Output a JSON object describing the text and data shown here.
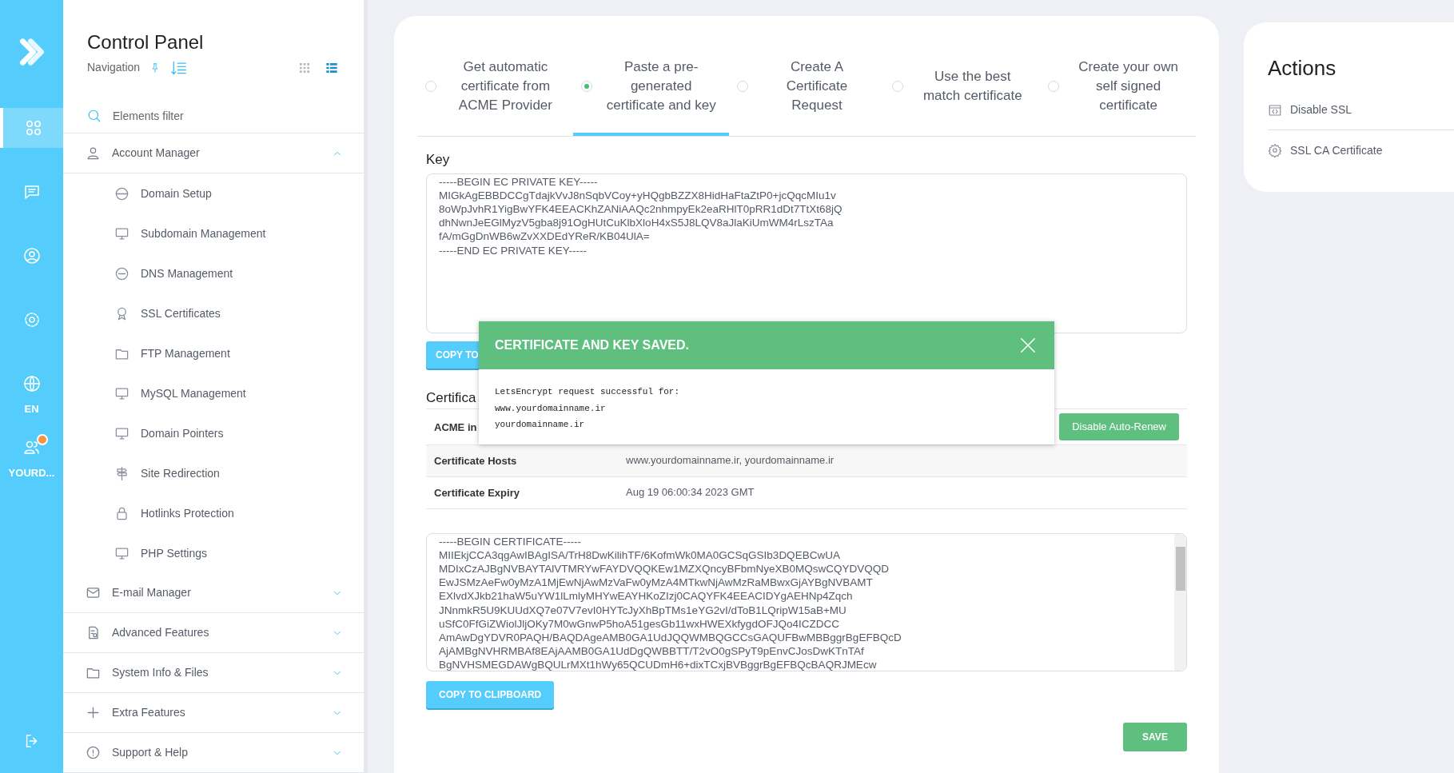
{
  "rail": {
    "items": [
      {
        "kind": "apps",
        "selected": true
      },
      {
        "kind": "chat",
        "selected": false
      },
      {
        "kind": "user",
        "selected": false
      },
      {
        "kind": "gear",
        "selected": false
      },
      {
        "kind": "globe",
        "selected": false,
        "label": "EN"
      },
      {
        "kind": "account",
        "selected": false,
        "label": "YOURD...",
        "notification": true
      }
    ]
  },
  "sidebar": {
    "title": "Control Panel",
    "subtitle": "Navigation",
    "view_toggle": [
      {
        "selected": false
      },
      {
        "selected": true
      }
    ],
    "filter": {
      "placeholder": "Elements filter"
    },
    "groups": [
      {
        "label": "Account Manager",
        "expanded": true,
        "children": [
          {
            "label": "Domain Setup"
          },
          {
            "label": "Subdomain Management"
          },
          {
            "label": "DNS Management"
          },
          {
            "label": "SSL Certificates"
          },
          {
            "label": "FTP Management"
          },
          {
            "label": "MySQL Management"
          },
          {
            "label": "Domain Pointers"
          },
          {
            "label": "Site Redirection"
          },
          {
            "label": "Hotlinks Protection"
          },
          {
            "label": "PHP Settings"
          }
        ]
      },
      {
        "label": "E-mail Manager",
        "expanded": false
      },
      {
        "label": "Advanced Features",
        "expanded": false
      },
      {
        "label": "System Info & Files",
        "expanded": false
      },
      {
        "label": "Extra Features",
        "expanded": false
      },
      {
        "label": "Support & Help",
        "expanded": false
      }
    ]
  },
  "tabs": [
    {
      "label": "Get automatic certificate from ACME Provider",
      "selected": false
    },
    {
      "label": "Paste a pre-generated certificate and key",
      "selected": true
    },
    {
      "label": "Create A Certificate Request",
      "selected": false
    },
    {
      "label": "Use the best match certificate",
      "selected": false
    },
    {
      "label": "Create your own self signed certificate",
      "selected": false
    }
  ],
  "key": {
    "label": "Key",
    "lines": [
      "-----BEGIN EC PRIVATE KEY-----",
      "MIGkAgEBBDCCgTdajkVvJ8nSqbVCoy+yHQgbBZZX8HidHaFtaZtP0+jcQqcMIu1v",
      "8oWpJvhR1YigBwYFK4EEACKhZANiAAQc2nhmpyEk2eaRHlT0pRR1dDt7TtXt68jQ",
      "dhNwnJeEGlMyzV5gba8j91OgHUtCuKlbXloH4xS5J8LQV8aJlaKiUmWM4rLszTAa",
      "fA/mGgDnWB6wZvXXDEdYReR/KB04UlA=",
      "-----END EC PRIVATE KEY-----"
    ],
    "copy_button": "COPY TO"
  },
  "certificate": {
    "heading": "Certifica",
    "rows": [
      {
        "label": "ACME in",
        "value": "",
        "button": "Disable Auto-Renew"
      },
      {
        "label": "Certificate Hosts",
        "value": "www.yourdomainname.ir, yourdomainname.ir"
      },
      {
        "label": "Certificate Expiry",
        "value": "Aug 19 06:00:34 2023 GMT"
      }
    ],
    "lines": [
      "-----BEGIN CERTIFICATE-----",
      "MIIEkjCCA3qgAwIBAgISA/TrH8DwKilihTF/6KofmWk0MA0GCSqGSIb3DQEBCwUA",
      "MDIxCzAJBgNVBAYTAlVTMRYwFAYDVQQKEw1MZXQncyBFbmNyeXB0MQswCQYDVQQD",
      "EwJSMzAeFw0yMzA1MjEwNjAwMzVaFw0yMzA4MTkwNjAwMzRaMBwxGjAYBgNVBAMT",
      "EXlvdXJkb21haW5uYW1lLmlyMHYwEAYHKoZIzj0CAQYFK4EEACIDYgAEHNp4Zqch",
      "JNnmkR5U9KUUdXQ7e07V7evI0HYTcJyXhBpTMs1eYG2vI/dToB1LQripW15aB+MU",
      "uSfC0FfGiZWiolJljOKy7M0wGnwP5hoA51gesGb11wxHWEXkfygdOFJQo4ICZDCC",
      "AmAwDgYDVR0PAQH/BAQDAgeAMB0GA1UdJQQWMBQGCCsGAQUFBwMBBggrBgEFBQcD",
      "AjAMBgNVHRMBAf8EAjAAMB0GA1UdDgQWBBTT/T2vO0gSPyT9pEnvCJosDwKTnTAf",
      "BgNVHSMEGDAWgBQULrMXt1hWy65QCUDmH6+dixTCxjBVBggrBgEFBQcBAQRJMEcw"
    ],
    "copy_button": "COPY TO CLIPBOARD"
  },
  "save_button": "SAVE",
  "toast": {
    "title": "CERTIFICATE AND KEY SAVED.",
    "lines": [
      "LetsEncrypt request successful for:",
      "www.yourdomainname.ir",
      "yourdomainname.ir"
    ]
  },
  "actions": {
    "title": "Actions",
    "items": [
      {
        "label": "Disable SSL"
      },
      {
        "label": "SSL CA Certificate"
      }
    ]
  }
}
